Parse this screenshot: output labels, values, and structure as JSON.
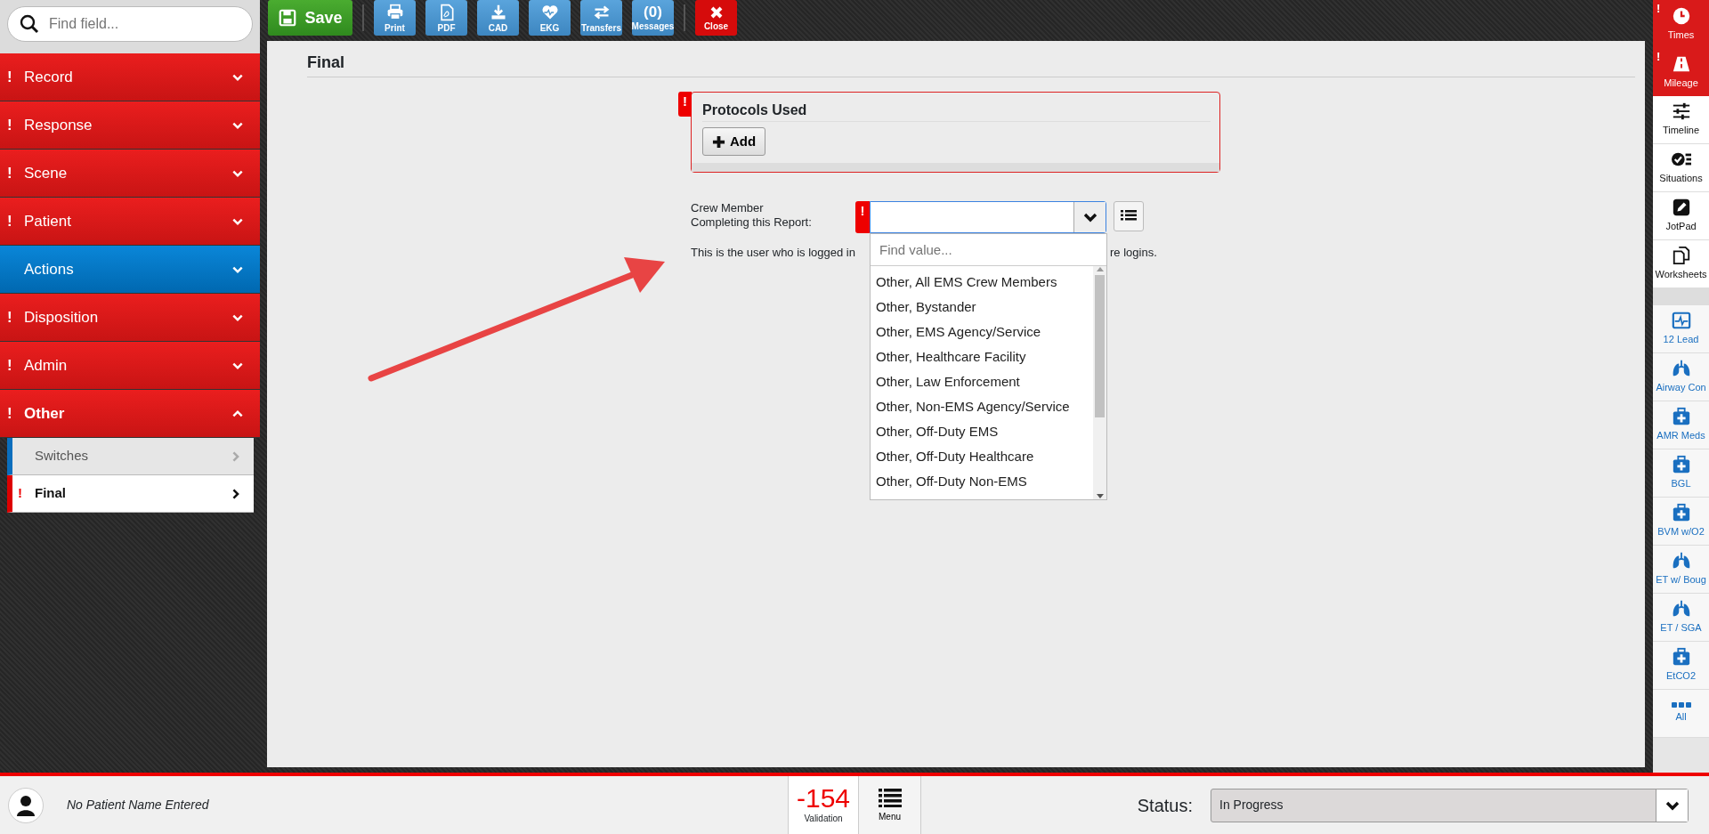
{
  "search": {
    "placeholder": "Find field..."
  },
  "toolbar": [
    {
      "kind": "save",
      "label": "Save"
    },
    {
      "kind": "tool",
      "label": "Print"
    },
    {
      "kind": "tool",
      "label": "PDF"
    },
    {
      "kind": "tool",
      "label": "CAD"
    },
    {
      "kind": "tool",
      "label": "EKG"
    },
    {
      "kind": "tool",
      "label": "Transfers"
    },
    {
      "kind": "count",
      "count": "(0)",
      "label": "Messages"
    },
    {
      "kind": "close",
      "label": "Close"
    }
  ],
  "sections": [
    {
      "badge": "!",
      "label": "Record",
      "alert": true,
      "expanded": false
    },
    {
      "badge": "!",
      "label": "Response",
      "alert": true,
      "expanded": false
    },
    {
      "badge": "!",
      "label": "Scene",
      "alert": true,
      "expanded": false
    },
    {
      "badge": "!",
      "label": "Patient",
      "alert": true,
      "expanded": false
    },
    {
      "label": "Actions",
      "alert": false,
      "expanded": false
    },
    {
      "badge": "!",
      "label": "Disposition",
      "alert": true,
      "expanded": false
    },
    {
      "badge": "!",
      "label": "Admin",
      "alert": true,
      "expanded": false
    },
    {
      "badge": "!",
      "label": "Other",
      "alert": true,
      "expanded": true,
      "children": [
        {
          "label": "Switches",
          "alert": false,
          "selected": false
        },
        {
          "badge": "!",
          "label": "Final",
          "alert": true,
          "selected": true
        }
      ]
    }
  ],
  "page": {
    "title": "Final",
    "protocols": {
      "badge": "!",
      "title": "Protocols Used",
      "alert": true,
      "add_button": "Add"
    },
    "crew_field": {
      "label": "Crew Member\nCompleting this Report:",
      "badge": "!",
      "alert": true,
      "help_text_parts": [
        "This is the user who is logged in",
        "re logins."
      ],
      "dropdown": {
        "open": true,
        "search_placeholder": "Find value...",
        "options": [
          "Other, All EMS Crew Members",
          "Other, Bystander",
          "Other, EMS Agency/Service",
          "Other, Healthcare Facility",
          "Other, Law Enforcement",
          "Other, Non-EMS Agency/Service",
          "Other, Off-Duty EMS",
          "Other, Off-Duty Healthcare",
          "Other, Off-Duty Non-EMS"
        ]
      }
    }
  },
  "right_bar": [
    {
      "badge": "!",
      "label": "Times",
      "kind": "tool",
      "alert": true
    },
    {
      "badge": "!",
      "label": "Mileage",
      "kind": "tool",
      "alert": true
    },
    {
      "label": "Timeline",
      "kind": "tool",
      "alert": false
    },
    {
      "label": "Situations",
      "kind": "tool",
      "alert": false
    },
    {
      "label": "JotPad",
      "kind": "tool",
      "alert": false
    },
    {
      "label": "Worksheets",
      "kind": "tool",
      "alert": false
    },
    {
      "label": "12 Lead",
      "kind": "protocol",
      "alert": false
    },
    {
      "label": "Airway Con",
      "kind": "protocol",
      "alert": false
    },
    {
      "label": "AMR Meds",
      "kind": "protocol",
      "alert": false
    },
    {
      "label": "BGL",
      "kind": "protocol",
      "alert": false
    },
    {
      "label": "BVM w/O2",
      "kind": "protocol",
      "alert": false
    },
    {
      "label": "ET w/ Boug",
      "kind": "protocol",
      "alert": false
    },
    {
      "label": "ET / SGA",
      "kind": "protocol",
      "alert": false
    },
    {
      "label": "EtCO2",
      "kind": "protocol",
      "alert": false
    },
    {
      "label": "All",
      "kind": "protocol",
      "alert": false
    }
  ],
  "bottom_bar": {
    "patient_name": "No Patient Name Entered",
    "validation_count": "-154",
    "validation_label": "Validation",
    "menu_label": "Menu",
    "status_label": "Status:",
    "status_value": "In Progress"
  }
}
